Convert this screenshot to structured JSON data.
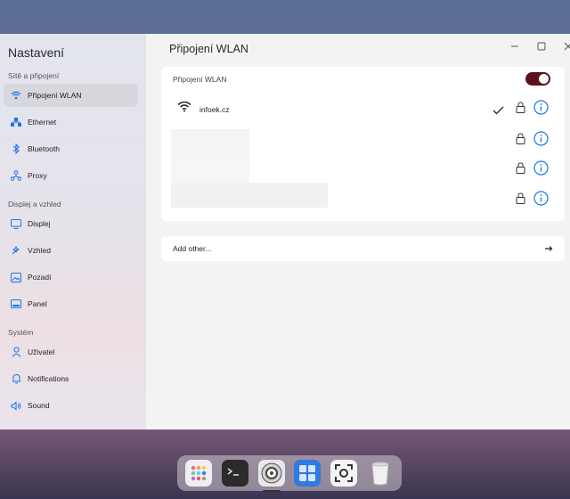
{
  "sidebar": {
    "title": "Nastavení",
    "sections": [
      {
        "label": "Sítě a připojení",
        "items": [
          "Připojení WLAN",
          "Ethernet",
          "Bluetooth",
          "Proxy"
        ]
      },
      {
        "label": "Displej a vzhled",
        "items": [
          "Displej",
          "Vzhled",
          "Pozadí",
          "Panel"
        ]
      },
      {
        "label": "Systém",
        "items": [
          "Uživatel",
          "Notifications",
          "Sound"
        ]
      }
    ],
    "active_item": "Připojení WLAN"
  },
  "main": {
    "title": "Připojení WLAN",
    "wlan_toggle_label": "Připojení WLAN",
    "wlan_enabled": true,
    "connected_network": "infoek.cz",
    "add_other_label": "Add other..."
  },
  "window_controls": {
    "minimize": "—",
    "maximize": "▢",
    "close": "✕"
  },
  "dock": {
    "apps": [
      "app-grid-icon",
      "terminal-icon",
      "settings-icon",
      "calculator-icon",
      "screenshot-icon",
      "trash-icon"
    ]
  },
  "colors": {
    "accent": "#1a73e8",
    "toggle_on": "#5a1020"
  }
}
